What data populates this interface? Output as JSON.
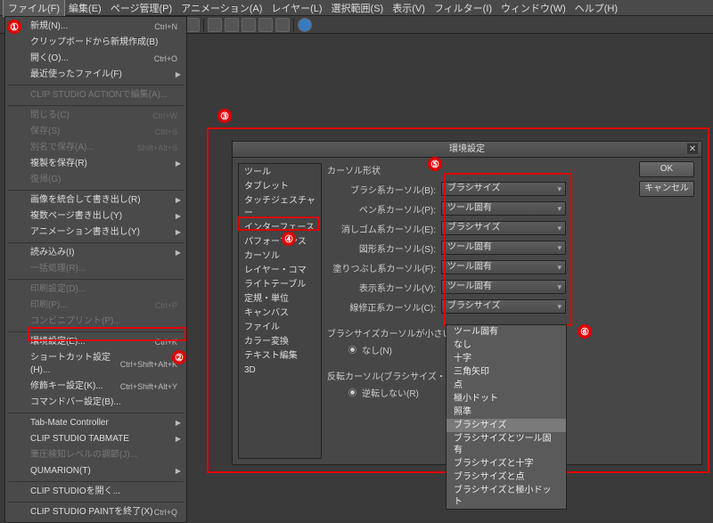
{
  "menubar": {
    "items": [
      "ファイル(F)",
      "編集(E)",
      "ページ管理(P)",
      "アニメーション(A)",
      "レイヤー(L)",
      "選択範囲(S)",
      "表示(V)",
      "フィルター(I)",
      "ウィンドウ(W)",
      "ヘルプ(H)"
    ],
    "active_index": 0
  },
  "file_menu": [
    {
      "label": "新規(N)...",
      "shortcut": "Ctrl+N",
      "type": "item"
    },
    {
      "label": "クリップボードから新規作成(B)",
      "type": "item"
    },
    {
      "label": "開く(O)...",
      "shortcut": "Ctrl+O",
      "type": "item"
    },
    {
      "label": "最近使ったファイル(F)",
      "type": "submenu"
    },
    {
      "type": "sep"
    },
    {
      "label": "CLIP STUDIO ACTIONで編集(A)...",
      "type": "item",
      "dim": true
    },
    {
      "type": "sep"
    },
    {
      "label": "閉じる(C)",
      "shortcut": "Ctrl+W",
      "type": "item",
      "dim": true
    },
    {
      "label": "保存(S)",
      "shortcut": "Ctrl+S",
      "type": "item",
      "dim": true
    },
    {
      "label": "別名で保存(A)...",
      "shortcut": "Shift+Alt+S",
      "type": "item",
      "dim": true
    },
    {
      "label": "複製を保存(R)",
      "type": "submenu"
    },
    {
      "label": "復帰(G)",
      "type": "item",
      "dim": true
    },
    {
      "type": "sep"
    },
    {
      "label": "画像を統合して書き出し(R)",
      "type": "submenu"
    },
    {
      "label": "複数ページ書き出し(Y)",
      "type": "submenu"
    },
    {
      "label": "アニメーション書き出し(Y)",
      "type": "submenu"
    },
    {
      "type": "sep"
    },
    {
      "label": "読み込み(I)",
      "type": "submenu"
    },
    {
      "label": "一括処理(R)...",
      "type": "item",
      "dim": true
    },
    {
      "type": "sep"
    },
    {
      "label": "印刷設定(D)...",
      "type": "item",
      "dim": true
    },
    {
      "label": "印刷(P)...",
      "shortcut": "Ctrl+P",
      "type": "item",
      "dim": true
    },
    {
      "label": "コンビニプリント(P)...",
      "type": "item",
      "dim": true
    },
    {
      "type": "sep"
    },
    {
      "label": "環境設定(E)...",
      "shortcut": "Ctrl+K",
      "type": "item"
    },
    {
      "label": "ショートカット設定(H)...",
      "shortcut": "Ctrl+Shift+Alt+K",
      "type": "item"
    },
    {
      "label": "修飾キー設定(K)...",
      "shortcut": "Ctrl+Shift+Alt+Y",
      "type": "item"
    },
    {
      "label": "コマンドバー設定(B)...",
      "type": "item"
    },
    {
      "type": "sep"
    },
    {
      "label": "Tab-Mate Controller",
      "type": "submenu"
    },
    {
      "label": "CLIP STUDIO TABMATE",
      "type": "submenu"
    },
    {
      "label": "筆圧検知レベルの調節(J)...",
      "type": "item",
      "dim": true
    },
    {
      "label": "QUMARION(T)",
      "type": "submenu"
    },
    {
      "type": "sep"
    },
    {
      "label": "CLIP STUDIOを開く...",
      "type": "item"
    },
    {
      "type": "sep"
    },
    {
      "label": "CLIP STUDIO PAINTを終了(X)",
      "shortcut": "Ctrl+Q",
      "type": "item"
    }
  ],
  "dialog": {
    "title": "環境設定",
    "ok": "OK",
    "cancel": "キャンセル",
    "categories": [
      "ツール",
      "タブレット",
      "タッチジェスチャー",
      "インターフェース",
      "パフォーマンス",
      "カーソル",
      "レイヤー・コマ",
      "ライトテーブル",
      "定規・単位",
      "キャンバス",
      "ファイル",
      "カラー変換",
      "テキスト編集",
      "3D"
    ],
    "section": "カーソル形状",
    "rows": [
      {
        "label": "ブラシ系カーソル(B):",
        "value": "ブラシサイズ"
      },
      {
        "label": "ペン系カーソル(P):",
        "value": "ツール固有"
      },
      {
        "label": "消しゴム系カーソル(E):",
        "value": "ブラシサイズ"
      },
      {
        "label": "図形系カーソル(S):",
        "value": "ツール固有"
      },
      {
        "label": "塗りつぶし系カーソル(F):",
        "value": "ツール固有"
      },
      {
        "label": "表示系カーソル(V):",
        "value": "ツール固有"
      },
      {
        "label": "線修正系カーソル(C):",
        "value": "ブラシサイズ"
      }
    ],
    "sub1": {
      "label": "ブラシサイズカーソルが小さい時の表",
      "opt": "なし(N)"
    },
    "sub2": {
      "label": "反転カーソル(ブラシサイズ・照準",
      "opt": "逆転しない(R)"
    }
  },
  "popup_options": [
    "ツール固有",
    "なし",
    "十字",
    "三角矢印",
    "点",
    "極小ドット",
    "照準",
    "ブラシサイズ",
    "ブラシサイズとツール固有",
    "ブラシサイズと十字",
    "ブラシサイズと点",
    "ブラシサイズと極小ドット"
  ],
  "popup_highlight_index": 7
}
